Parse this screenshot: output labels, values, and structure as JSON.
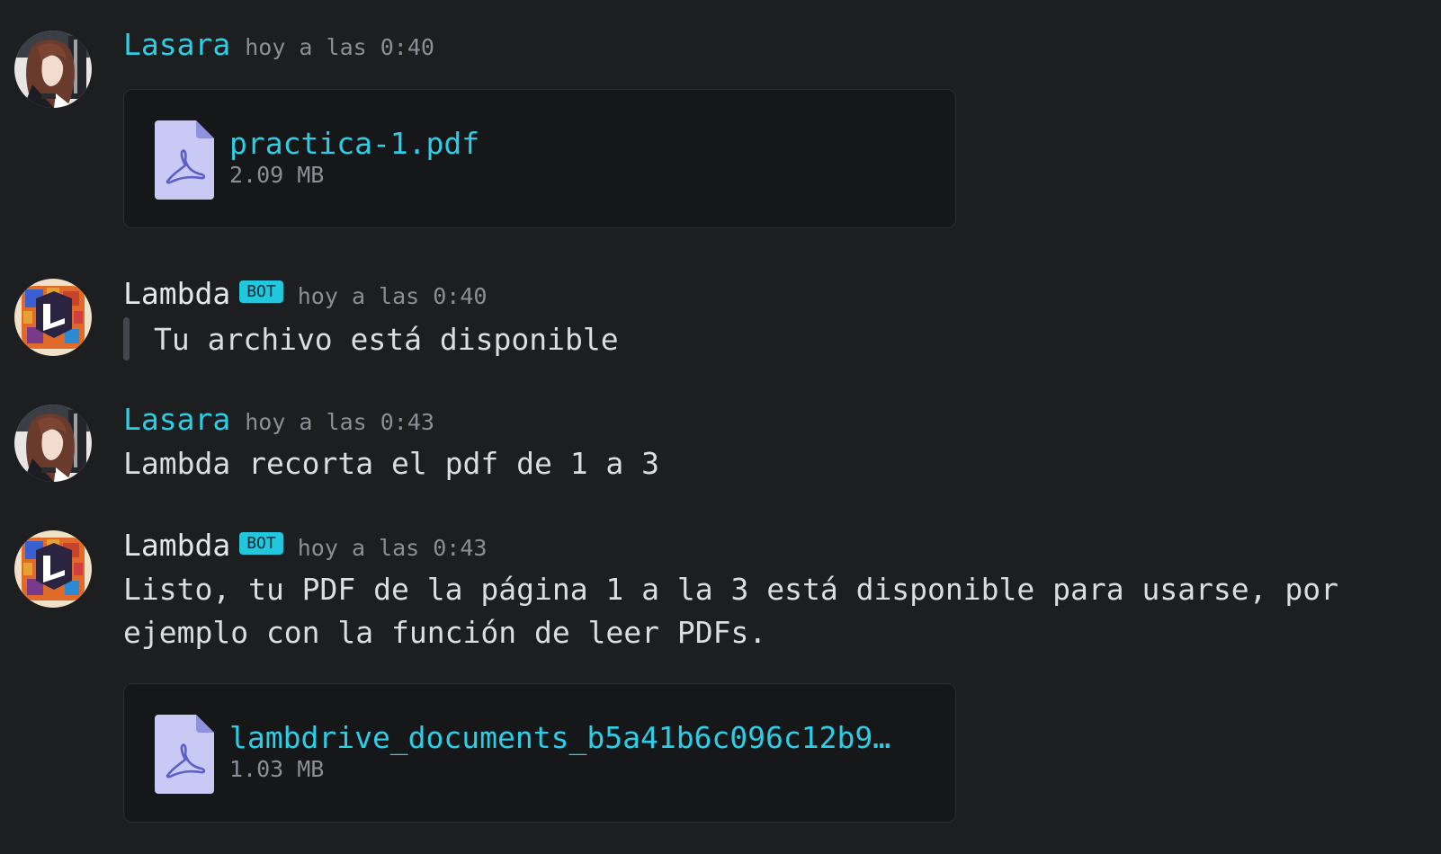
{
  "colors": {
    "background": "#1c1e20",
    "user_name": "#2ecde6",
    "bot_name": "#e6e7ea",
    "bot_badge": "#22c6dd",
    "link": "#2ecde6",
    "muted": "#8b8f95",
    "attachment_bg": "#151719",
    "file_icon": "#c9c9f5",
    "file_icon_glyph": "#5b5fc7"
  },
  "messages": [
    {
      "author": "Lasara",
      "is_bot": false,
      "timestamp": "hoy a las 0:40",
      "attachment": {
        "icon": "pdf-file-icon",
        "name": "practica-1.pdf",
        "size": "2.09 MB"
      }
    },
    {
      "author": "Lambda",
      "is_bot": true,
      "badge": "BOT",
      "timestamp": "hoy a las 0:40",
      "quote": "Tu archivo está disponible"
    },
    {
      "author": "Lasara",
      "is_bot": false,
      "timestamp": "hoy a las 0:43",
      "text": "Lambda recorta el pdf de 1 a 3"
    },
    {
      "author": "Lambda",
      "is_bot": true,
      "badge": "BOT",
      "timestamp": "hoy a las 0:43",
      "text_line1": "Listo, tu PDF de la página 1 a la 3 está disponible para usarse, por",
      "text_line2": "ejemplo con la función de leer PDFs.",
      "attachment": {
        "icon": "pdf-file-icon",
        "name": "lambdrive_documents_b5a41b6c096c12b9…",
        "size": "1.03 MB"
      }
    }
  ]
}
